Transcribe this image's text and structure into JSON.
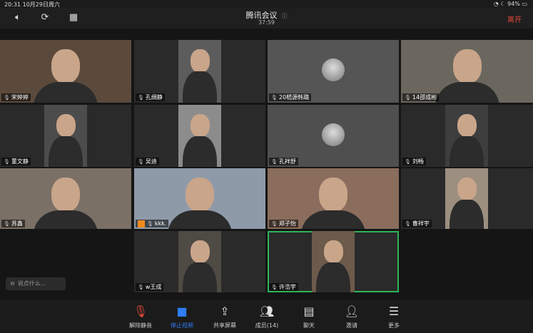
{
  "status": {
    "time_date": "20:31  10月29日周六",
    "battery": "94%"
  },
  "header": {
    "title": "腾讯会议",
    "timer": "37:59",
    "leave": "离开"
  },
  "participants": [
    {
      "name": "宋婷婷",
      "bg": "#5b4a3c"
    },
    {
      "name": "孔绸静",
      "bg": "#5c5c5c"
    },
    {
      "name": "20嵇源韩璐",
      "bg": "#555555"
    },
    {
      "name": "14邵成彬",
      "bg": "#6b675e"
    },
    {
      "name": "董文静",
      "bg": "#4c4c4c"
    },
    {
      "name": "吴迪",
      "bg": "#8c8c8c"
    },
    {
      "name": "孔祥舒",
      "bg": "#4f4f4f"
    },
    {
      "name": "刘畅",
      "bg": "#3e3e3e"
    },
    {
      "name": "苏鑫",
      "bg": "#7b7066"
    },
    {
      "name": "kkk.",
      "bg": "#8f9aa8"
    },
    {
      "name": "郑子怡",
      "bg": "#8a6d5c"
    },
    {
      "name": "曹祥宇",
      "bg": "#9c8f80"
    },
    {
      "name": "w王成",
      "bg": "#4e4a44"
    },
    {
      "name": "许浩宇",
      "bg": "#6c5a4a"
    }
  ],
  "chat": {
    "placeholder": "说点什么..."
  },
  "toolbar": [
    {
      "label": "解除静音",
      "icon": "mic-muted-icon"
    },
    {
      "label": "停止视频",
      "icon": "video-camera-icon"
    },
    {
      "label": "共享屏幕",
      "icon": "share-screen-icon"
    },
    {
      "label": "成员(14)",
      "icon": "members-icon"
    },
    {
      "label": "聊天",
      "icon": "chat-icon"
    },
    {
      "label": "邀请",
      "icon": "invite-icon"
    },
    {
      "label": "更多",
      "icon": "more-icon"
    }
  ]
}
